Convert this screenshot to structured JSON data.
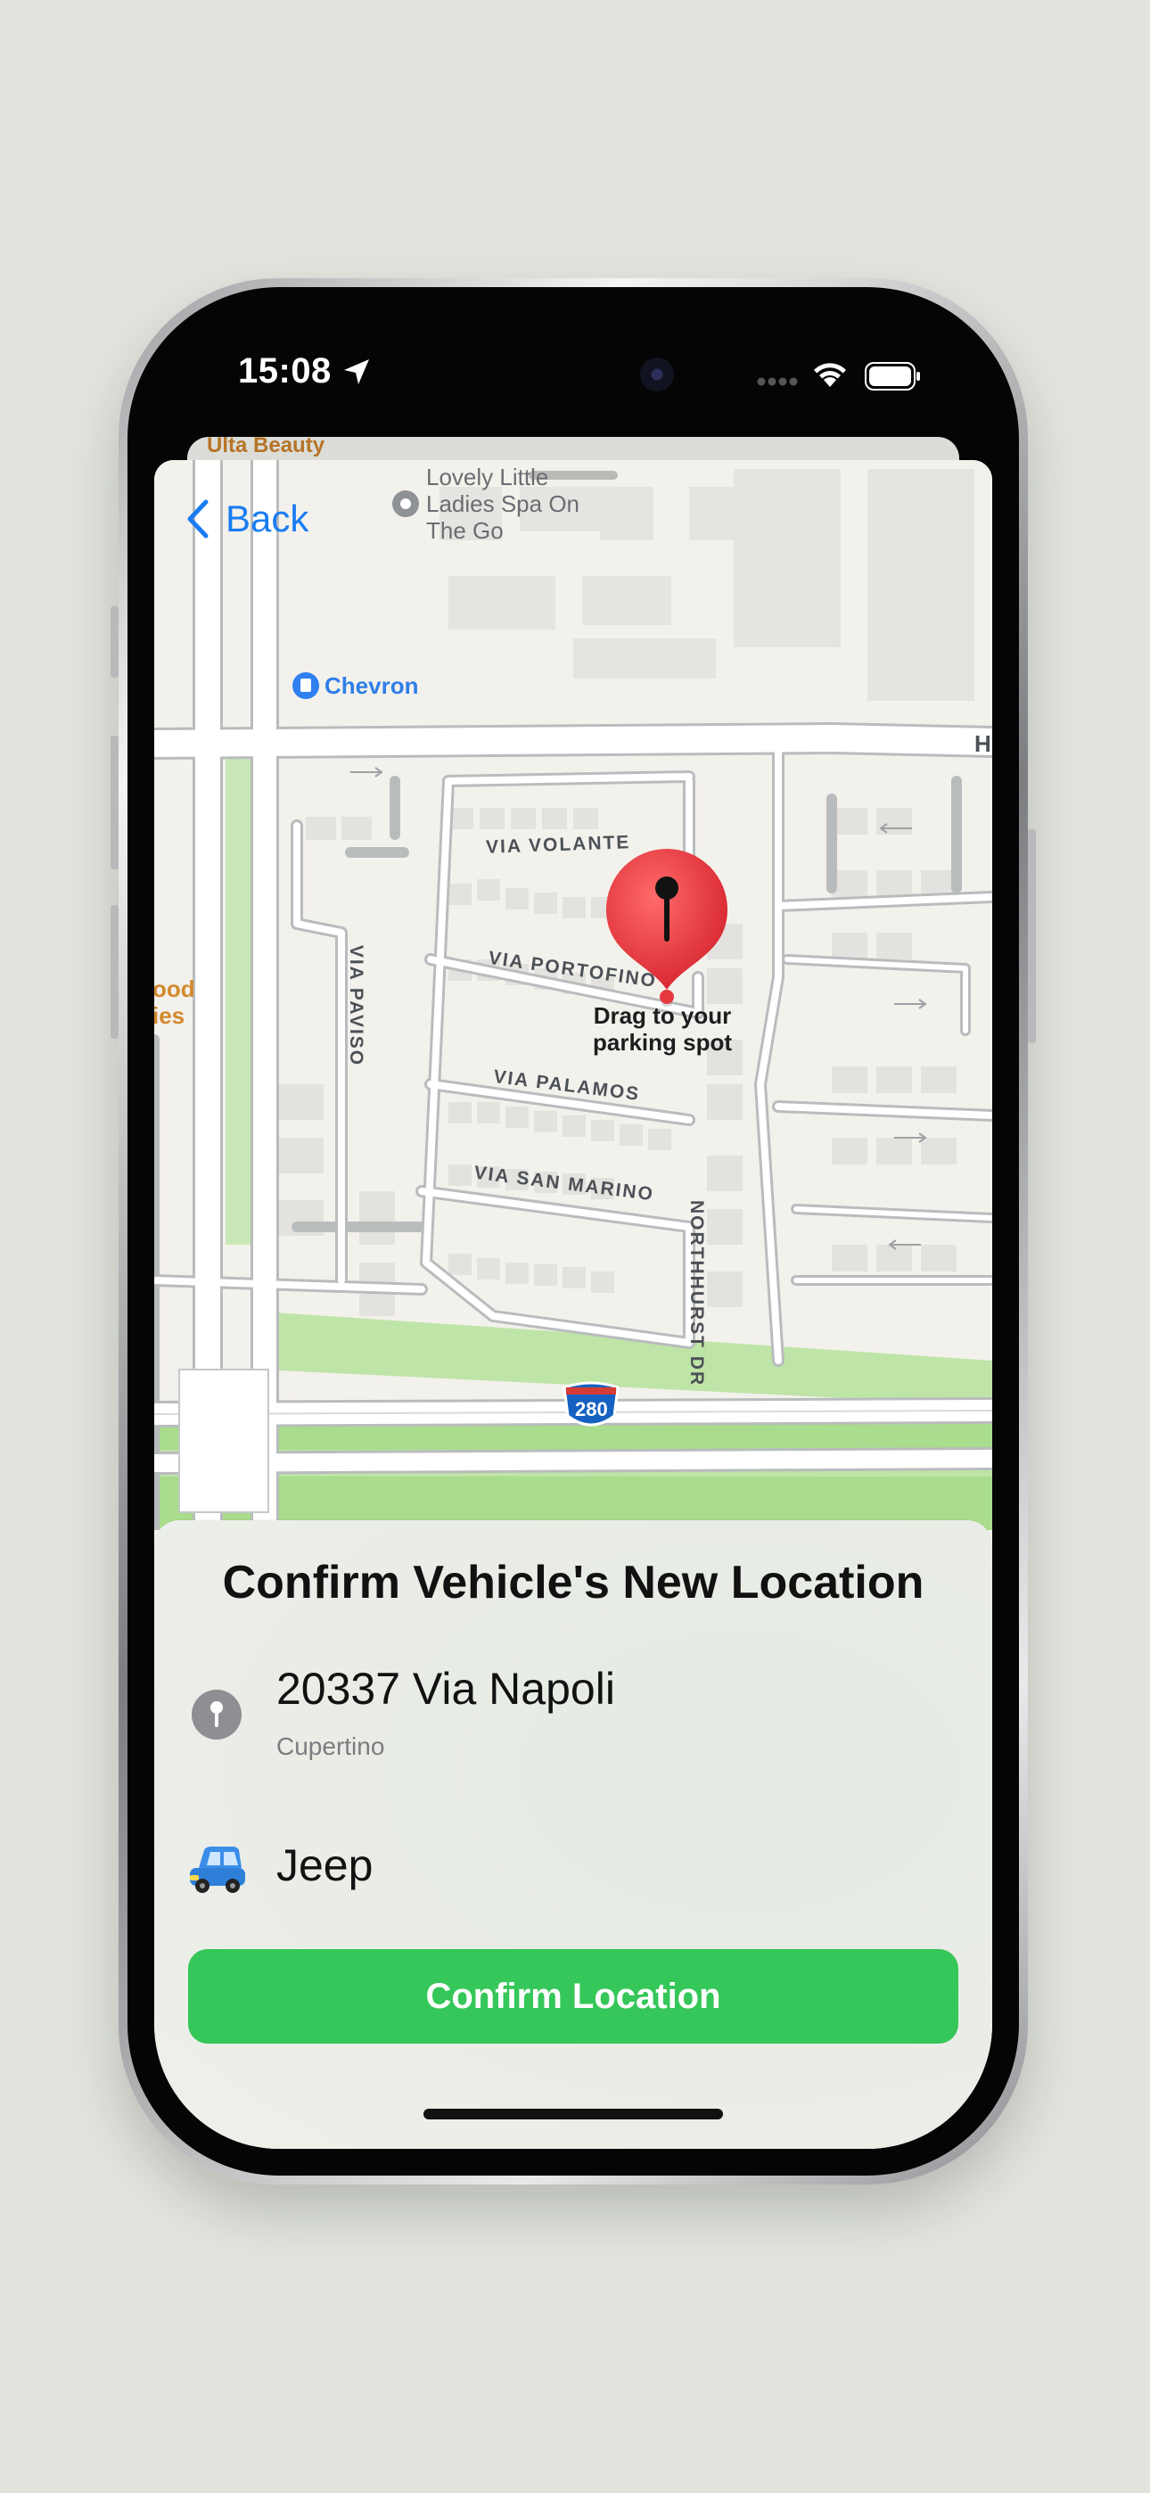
{
  "status_bar": {
    "time": "15:08"
  },
  "navigation": {
    "back_label": "Back"
  },
  "map": {
    "poi_background": "Ulta Beauty",
    "poi_spa": "Lovely Little Ladies Spa On The Go",
    "poi_spa_line1": "Lovely Little",
    "poi_spa_line2": "Ladies Spa On",
    "poi_spa_line3": "The Go",
    "poi_gas": "Chevron",
    "poi_edge_line1": "ood",
    "poi_edge_line2": "ies",
    "edge_letter": "H",
    "streets": {
      "via_volante": "VIA VOLANTE",
      "via_paviso": "VIA PAVISO",
      "via_portofino": "VIA PORTOFINO",
      "via_palamos": "VIA PALAMOS",
      "via_san_marino": "VIA SAN MARINO",
      "northhurst": "NORTHHURST DR"
    },
    "highway_shield": "280",
    "pin_hint_line1": "Drag to your",
    "pin_hint_line2": "parking spot"
  },
  "panel": {
    "title": "Confirm Vehicle's New Location",
    "address": "20337 Via Napoli",
    "city": "Cupertino",
    "vehicle": "Jeep",
    "confirm_label": "Confirm Location"
  },
  "colors": {
    "accent_blue": "#1a7cf2",
    "confirm_green": "#35c759",
    "pin_red": "#e8323c"
  }
}
